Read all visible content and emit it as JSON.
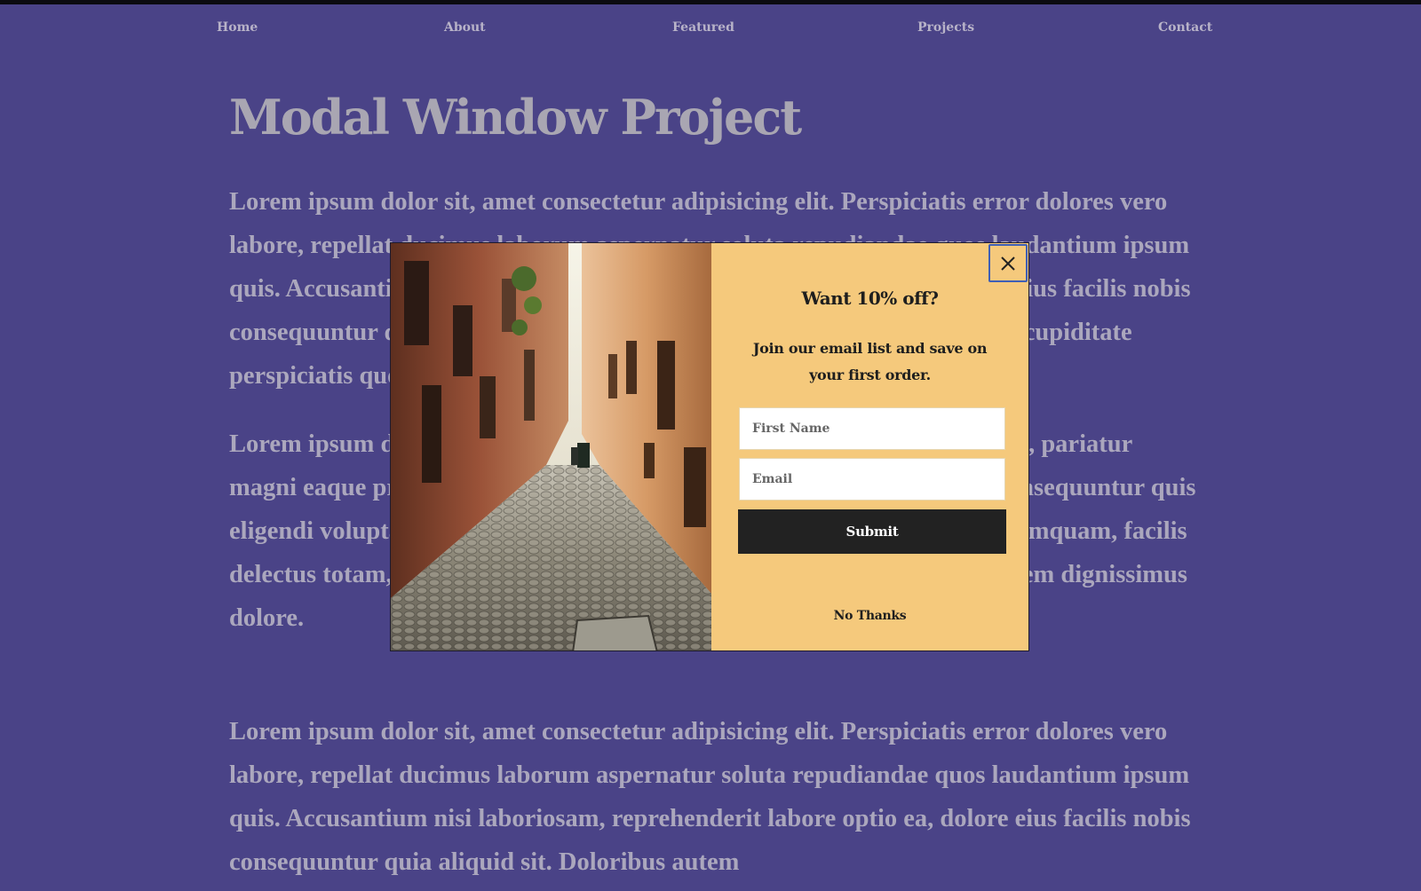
{
  "nav": {
    "home": "Home",
    "about": "About",
    "featured": "Featured",
    "projects": "Projects",
    "contact": "Contact"
  },
  "page": {
    "title": "Modal Window Project",
    "paragraph_1": "Lorem ipsum dolor sit, amet consectetur adipisicing elit. Perspiciatis error dolores vero labore, repellat ducimus laborum aspernatur soluta repudiandae quos laudantium ipsum quis. Accusantium nisi laboriosam, reprehenderit labore optio ea, dolore eius facilis nobis consequuntur quia aliquid sit. Doloribus autem repudiandae perferendis, cupiditate perspiciatis quod fugit sed!",
    "paragraph_2": "Lorem ipsum dolor sit amet consectetur adipisicing elit. Impedit, temporis, pariatur magni eaque praesentium, dolorem corporis sed numquam possimus? Consequuntur quis eligendi voluptatum, soluta est cumque, cumque neque aliquid maiores numquam, facilis delectus totam, nam, facere placeat repudiandae omnis atque exercitationem dignissimus dolore.",
    "paragraph_3": "Lorem ipsum dolor sit, amet consectetur adipisicing elit. Perspiciatis error dolores vero labore, repellat ducimus laborum aspernatur soluta repudiandae quos laudantium ipsum quis. Accusantium nisi laboriosam, reprehenderit labore optio ea, dolore eius facilis nobis consequuntur quia aliquid sit. Doloribus autem"
  },
  "modal": {
    "heading": "Want 10% off?",
    "text": "Join our email list and save on your first order.",
    "first_name_placeholder": "First Name",
    "email_placeholder": "Email",
    "submit_label": "Submit",
    "no_thanks_label": "No Thanks",
    "close_icon": "close-icon",
    "image": "cobblestone-alley-photo"
  },
  "colors": {
    "background": "#4a4387",
    "modal_panel": "#f5c97c",
    "submit": "#222222",
    "close_border": "#3f5fb5"
  }
}
